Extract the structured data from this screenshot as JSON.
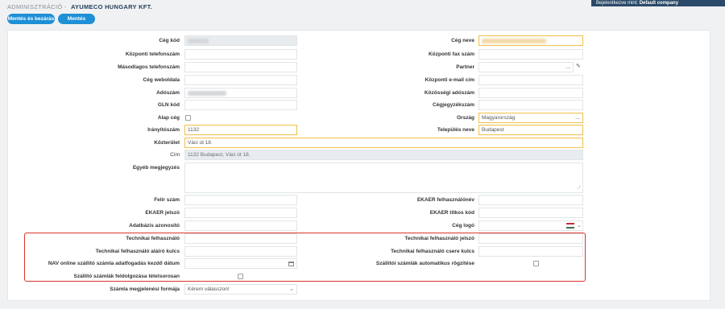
{
  "header": {
    "section": "ADMINISZTRÁCIÓ -",
    "company": "AYUMECO HUNGARY KFT.",
    "login_prefix": "Bejelentkezve mint:",
    "login_user": "Default company"
  },
  "toolbar": {
    "save_close_label": "Mentés és bezárás",
    "save_label": "Mentés"
  },
  "labels": {
    "ceg_kod": "Cég kód",
    "kozponti_telefon": "Központi telefonszám",
    "masodlagos_telefon": "Másodlagos telefonszám",
    "ceg_weboldala": "Cég weboldala",
    "adoszam": "Adószám",
    "gln_kod": "GLN kód",
    "alap_ceg": "Alap cég",
    "iranyitoszam": "Irányítószám",
    "kozterulet": "Közterület",
    "cim": "Cím",
    "egyeb_megjegyzes": "Egyéb megjegyzés",
    "felir_szam": "Felír szám",
    "ekaer_jelszo": "EKAER jelszó",
    "adatbazis_azonosito": "Adatbázis azonosító",
    "technikai_felhasznalo": "Technikai felhasználó",
    "technikai_alairo_kulcs": "Technikai felhasználó aláíró kulcs",
    "nav_datum": "NAV online szállító számla adatfogadás kezdő dátum",
    "szallito_tetelsoros": "Szállító számlák feldolgozása tételsorosan",
    "szamla_forma": "Számla megjelenési formája",
    "ceg_neve": "Cég neve",
    "kozponti_fax": "Központi fax szám",
    "partner": "Partner",
    "kozponti_email": "Központi e-mail cím",
    "kozossegi_adoszam": "Közösségi adószám",
    "cegjegyzekszam": "Cégjegyzékszám",
    "orszag": "Ország",
    "telepules": "Település neve",
    "ekaer_felhasznalonev": "EKAER felhasználónév",
    "ekaer_titkos_kod": "EKAER titkos kód",
    "ceg_logo": "Cég logó",
    "technikai_jelszo": "Technikai felhasználó jelszó",
    "technikai_csere_kulcs": "Technikai felhasználó csere kulcs",
    "szallitoi_auto": "Szállítói számlák automatikus rögzítése"
  },
  "values": {
    "orszag": "Magyarország",
    "iranyitoszam": "1132",
    "telepules": "Budapest",
    "kozterulet": "Váci út 18.",
    "cim": "1132 Budapest, Váci út 18.",
    "szamla_forma_placeholder": "Kérem válasszon!",
    "partner_dots": "...",
    "orszag_dots": "..."
  },
  "colors": {
    "accent": "#1f8fd6",
    "required_border": "#f0c04a",
    "highlight": "#d9342b",
    "header_bg": "#2b4a69"
  }
}
